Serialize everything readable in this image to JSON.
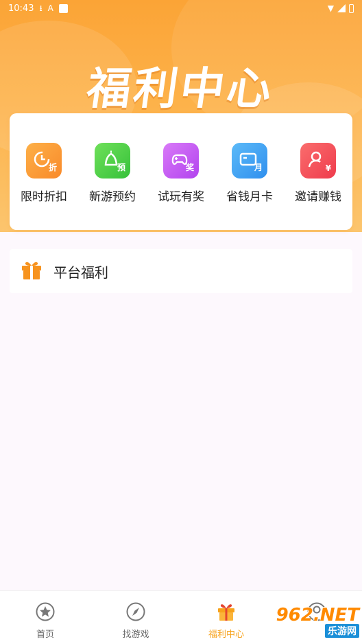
{
  "status_bar": {
    "time": "10:43"
  },
  "hero": {
    "title": "福利中心"
  },
  "features": [
    {
      "label": "限时折扣",
      "icon": "clock-discount-icon",
      "glyph": "折",
      "color": "#fb9c36"
    },
    {
      "label": "新游预约",
      "icon": "bell-reserve-icon",
      "glyph": "预",
      "color": "#4fcf47"
    },
    {
      "label": "试玩有奖",
      "icon": "gamepad-reward-icon",
      "glyph": "奖",
      "color": "#c759f4"
    },
    {
      "label": "省钱月卡",
      "icon": "monthly-card-icon",
      "glyph": "月",
      "color": "#3ea3f3"
    },
    {
      "label": "邀请赚钱",
      "icon": "invite-earn-icon",
      "glyph": "¥",
      "color": "#f7535c"
    }
  ],
  "section": {
    "title": "平台福利",
    "icon": "gift-icon"
  },
  "tabs": [
    {
      "label": "首页",
      "icon": "star-icon",
      "active": false
    },
    {
      "label": "找游戏",
      "icon": "compass-icon",
      "active": false
    },
    {
      "label": "福利中心",
      "icon": "gift-icon",
      "active": true
    },
    {
      "label": "",
      "icon": "user-icon",
      "active": false
    }
  ],
  "watermark": {
    "top": "962.NET",
    "bottom": "乐游网"
  },
  "colors": {
    "accent": "#f7a21b",
    "hero": "#fba436"
  }
}
